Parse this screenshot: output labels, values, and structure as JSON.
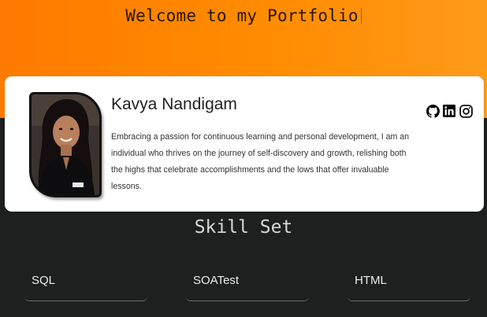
{
  "header": {
    "title": "Welcome to my Portfolio"
  },
  "profile": {
    "name": "Kavya Nandigam",
    "bio": "Embracing a passion for continuous learning and personal development, I am an individual who thrives on the journey of self-discovery and growth, relishing both the highs that celebrate accomplishments and the lows that offer invaluable lessons.",
    "social": [
      {
        "icon": "github-icon"
      },
      {
        "icon": "linkedin-icon"
      },
      {
        "icon": "instagram-icon"
      }
    ]
  },
  "skills": {
    "title": "Skill Set",
    "items": [
      {
        "label": "SQL"
      },
      {
        "label": "SOATest"
      },
      {
        "label": "HTML"
      }
    ]
  },
  "colors": {
    "accent_orange": "#ff7a00",
    "dark_background": "#1e1f1f",
    "card_background": "#ffffff"
  }
}
